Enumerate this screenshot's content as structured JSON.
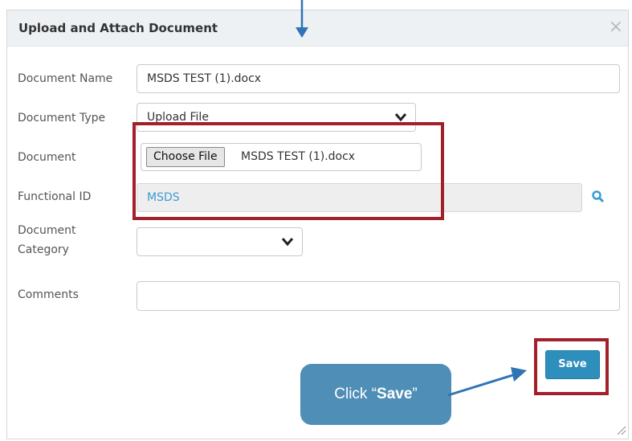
{
  "dialog": {
    "title": "Upload and Attach Document",
    "close_symbol": "×"
  },
  "form": {
    "document_name_label": "Document Name",
    "document_name_value": "MSDS TEST (1).docx",
    "document_type_label": "Document Type",
    "document_type_value": "Upload File",
    "document_label": "Document",
    "choose_file_label": "Choose File",
    "chosen_file_name": "MSDS TEST (1).docx",
    "functional_id_label": "Functional ID",
    "functional_id_value": "MSDS",
    "document_category_label_line1": "Document",
    "document_category_label_line2": "Category",
    "document_category_value": "",
    "comments_label": "Comments",
    "comments_value": ""
  },
  "actions": {
    "save_label": "Save"
  },
  "callout": {
    "prefix": "Click “",
    "bold": "Save",
    "suffix": "”"
  },
  "colors": {
    "highlight": "#a31f2a",
    "save_button": "#2e8fbd",
    "callout": "#4f8eb6",
    "arrow": "#2f74b5",
    "functional_id_text": "#3a9bd5"
  },
  "icons": {
    "close": "close-icon",
    "search": "search-icon",
    "dropdown": "chevron-down-icon",
    "resize": "resize-handle-icon"
  }
}
